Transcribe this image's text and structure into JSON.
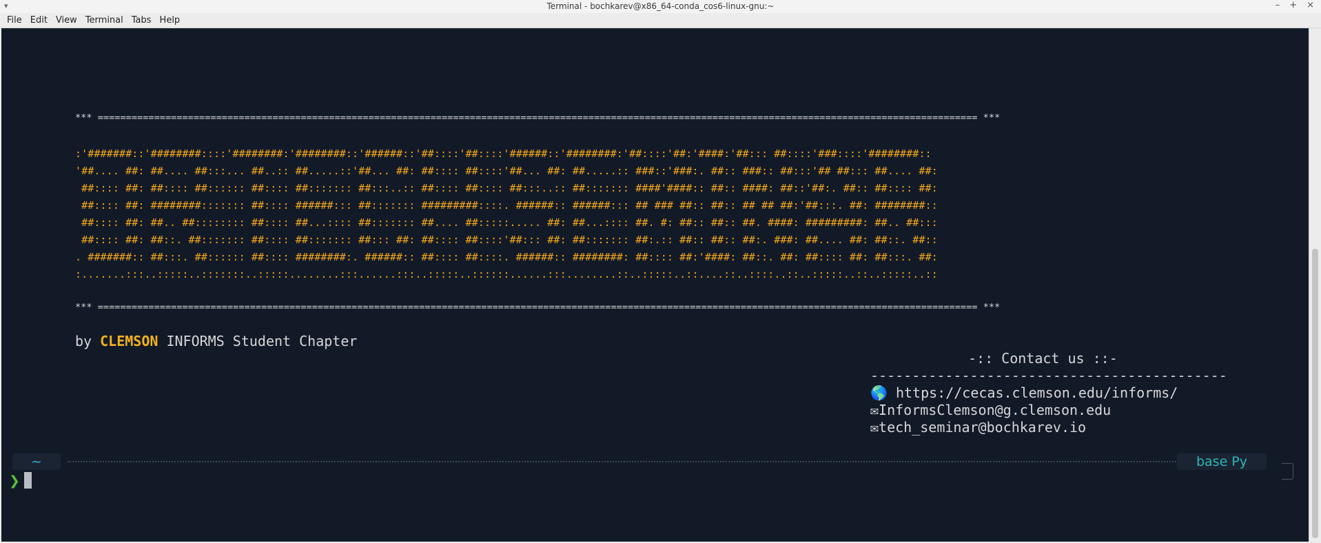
{
  "window": {
    "title": "Terminal - bochkarev@x86_64-conda_cos6-linux-gnu:~",
    "menu_glyph": "▾",
    "controls": [
      "–",
      "+",
      "×"
    ]
  },
  "menubar": [
    "File",
    "Edit",
    "View",
    "Terminal",
    "Tabs",
    "Help"
  ],
  "banner": {
    "rule_top": "*** ============================================================================================================================================================ ***",
    "art": [
      ":'#######::'########::::'########:'########::'######::'##::::'##::::'######::'########:'##::::'##:'####:'##::: ##::::'###::::'########::",
      "'##.... ##: ##.... ##:::... ##..:: ##.....::'##... ##: ##:::: ##::::'##... ##: ##.....:: ###::'###:. ##:: ###:: ##:::'## ##::: ##.... ##:",
      " ##:::: ##: ##:::: ##:::::: ##:::: ##::::::: ##:::..:: ##:::: ##:::: ##:::..:: ##::::::: ####'####:: ##:: ####: ##::'##:. ##:: ##:::: ##:",
      " ##:::: ##: ########::::::: ##:::: ######::: ##::::::: #########::::. ######:: ######::: ## ### ##:: ##:: ## ## ##:'##:::. ##: ########::",
      " ##:::: ##: ##.. ##:::::::: ##:::: ##...:::: ##::::::: ##.... ##:::::..... ##: ##...:::: ##. #: ##:: ##:: ##. ####: #########: ##.. ##:::",
      " ##:::: ##: ##::. ##::::::: ##:::: ##::::::: ##::: ##: ##:::: ##::::'##::: ##: ##::::::: ##:.:: ##:: ##:: ##:. ###: ##.... ##: ##::. ##::",
      ". #######:: ##:::. ##:::::: ##:::: ########:. ######:: ##:::: ##::::. ######:: ########: ##:::: ##:'####: ##::. ##: ##:::: ##: ##:::. ##:",
      ":.......:::..:::::..:::::::..:::::........:::......:::..:::::..::::::......:::........::..:::::..::....::..::::..::..:::::..::..:::::..::"
    ],
    "rule_bottom": "*** ============================================================================================================================================================ ***"
  },
  "byline": {
    "prefix": "by ",
    "highlight": "CLEMSON",
    "suffix": " INFORMS Student Chapter"
  },
  "contact": {
    "heading": "-:: Contact us ::-",
    "rule": "-------------------------------------------",
    "globe_icon": "🌎",
    "mail_icon": "✉",
    "website": " https://cecas.clemson.edu/informs/",
    "email1": "InformsClemson@g.clemson.edu",
    "email2": "tech_seminar@bochkarev.io"
  },
  "prompt": {
    "cwd": "~",
    "env": "base Py",
    "chevron": "❯"
  },
  "colors": {
    "background": "#121a28",
    "art": "#f5a81e",
    "text": "#d7d7d7",
    "accent": "#f5b21c",
    "cwd": "#2fb0d8",
    "env": "#2db8b8",
    "chevron": "#55c239"
  }
}
